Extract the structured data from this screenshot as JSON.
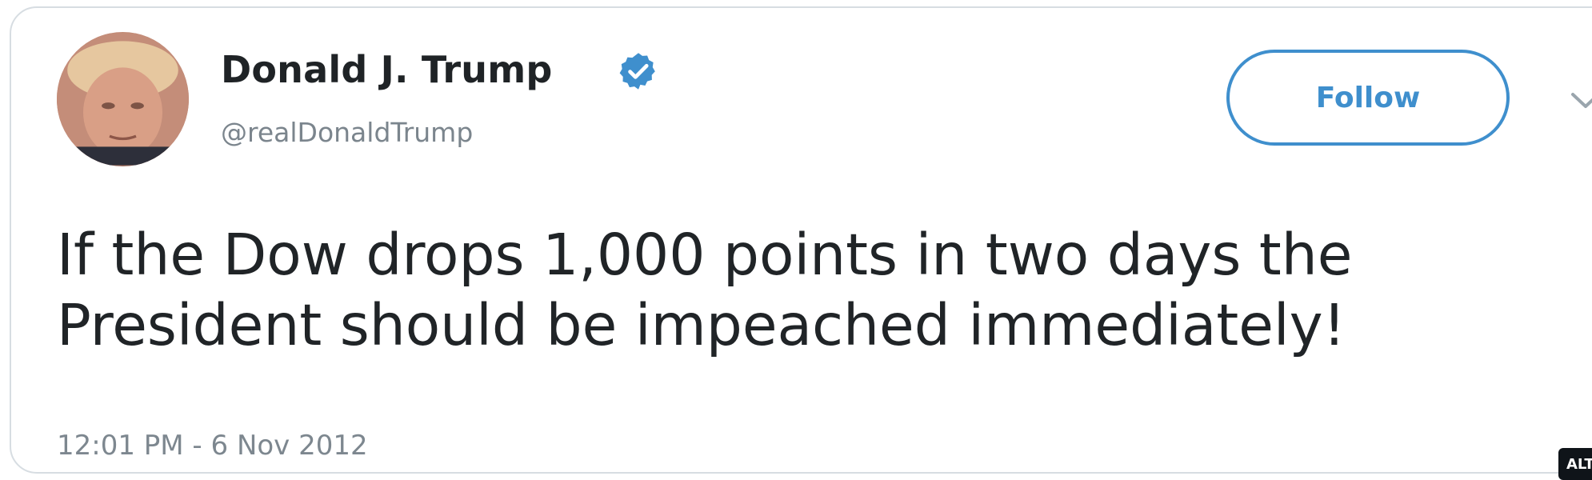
{
  "tweet": {
    "author": {
      "name": "Donald J. Trump",
      "handle": "@realDonaldTrump",
      "verified": true,
      "avatar_icon": "profile-photo"
    },
    "follow_label": "Follow",
    "menu_icon": "chevron-down-icon",
    "text": "If the Dow drops 1,000 points in two days the\nPresident should be impeached immediately!",
    "timestamp": "12:01 PM - 6 Nov 2012"
  },
  "badge": {
    "alt_label": "ALT"
  },
  "colors": {
    "accent": "#3f8fcd",
    "text": "#202427",
    "muted": "#7b858d",
    "border": "#d7dde2"
  }
}
